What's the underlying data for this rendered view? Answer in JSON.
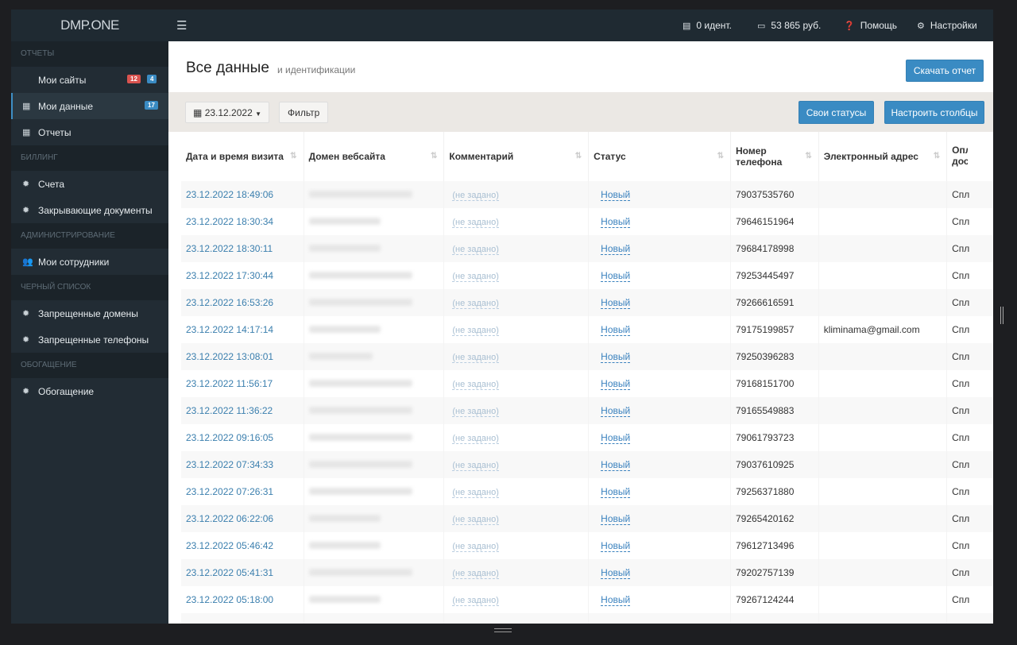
{
  "topbar": {
    "logo": "DMP.ONE",
    "ident": "0 идент.",
    "balance": "53 865 руб.",
    "help": "Помощь",
    "settings": "Настройки"
  },
  "sidebar": {
    "sections": [
      {
        "title": "Отчеты",
        "items": [
          {
            "label": "Мои сайты",
            "icon": "code-icon",
            "badges": [
              {
                "text": "12",
                "color": "#d9534f"
              },
              {
                "text": "4",
                "color": "#3a8bc3"
              }
            ]
          },
          {
            "label": "Мои данные",
            "icon": "table-icon",
            "active": true,
            "badges": [
              {
                "text": "17",
                "color": "#3a8bc3"
              }
            ]
          },
          {
            "label": "Отчеты",
            "icon": "table-icon"
          }
        ]
      },
      {
        "title": "Биллинг",
        "items": [
          {
            "label": "Счета",
            "icon": "gear-icon"
          },
          {
            "label": "Закрывающие документы",
            "icon": "gear-icon"
          }
        ]
      },
      {
        "title": "Администрирование",
        "items": [
          {
            "label": "Мои сотрудники",
            "icon": "users-icon"
          }
        ]
      },
      {
        "title": "Черный список",
        "items": [
          {
            "label": "Запрещенные домены",
            "icon": "gear-icon"
          },
          {
            "label": "Запрещенные телефоны",
            "icon": "gear-icon"
          }
        ]
      },
      {
        "title": "Обогащение",
        "items": [
          {
            "label": "Обогащение",
            "icon": "gear-icon"
          }
        ]
      }
    ]
  },
  "page": {
    "title": "Все данные",
    "subtitle": "и идентификации",
    "download": "Скачать отчет"
  },
  "toolbar": {
    "date": "23.12.2022",
    "filter": "Фильтр",
    "statuses": "Свои статусы",
    "columns": "Настроить столбцы"
  },
  "table": {
    "columns": [
      "Дата и время визита",
      "Домен вебсайта",
      "Комментарий",
      "Статус",
      "Номер телефона",
      "Электронный адрес",
      "Опл дост"
    ],
    "comment_default": "(не задано)",
    "status_default": "Новый",
    "last_col_value": "Спл",
    "rows": [
      {
        "date": "23.12.2022 18:49:06",
        "phone": "79037535760",
        "email": ""
      },
      {
        "date": "23.12.2022 18:30:34",
        "phone": "79646151964",
        "email": ""
      },
      {
        "date": "23.12.2022 18:30:11",
        "phone": "79684178998",
        "email": ""
      },
      {
        "date": "23.12.2022 17:30:44",
        "phone": "79253445497",
        "email": ""
      },
      {
        "date": "23.12.2022 16:53:26",
        "phone": "79266616591",
        "email": ""
      },
      {
        "date": "23.12.2022 14:17:14",
        "phone": "79175199857",
        "email": "kliminama@gmail.com"
      },
      {
        "date": "23.12.2022 13:08:01",
        "phone": "79250396283",
        "email": ""
      },
      {
        "date": "23.12.2022 11:56:17",
        "phone": "79168151700",
        "email": ""
      },
      {
        "date": "23.12.2022 11:36:22",
        "phone": "79165549883",
        "email": ""
      },
      {
        "date": "23.12.2022 09:16:05",
        "phone": "79061793723",
        "email": ""
      },
      {
        "date": "23.12.2022 07:34:33",
        "phone": "79037610925",
        "email": ""
      },
      {
        "date": "23.12.2022 07:26:31",
        "phone": "79256371880",
        "email": ""
      },
      {
        "date": "23.12.2022 06:22:06",
        "phone": "79265420162",
        "email": ""
      },
      {
        "date": "23.12.2022 05:46:42",
        "phone": "79612713496",
        "email": ""
      },
      {
        "date": "23.12.2022 05:41:31",
        "phone": "79202757139",
        "email": ""
      },
      {
        "date": "23.12.2022 05:18:00",
        "phone": "79267124244",
        "email": ""
      }
    ]
  }
}
